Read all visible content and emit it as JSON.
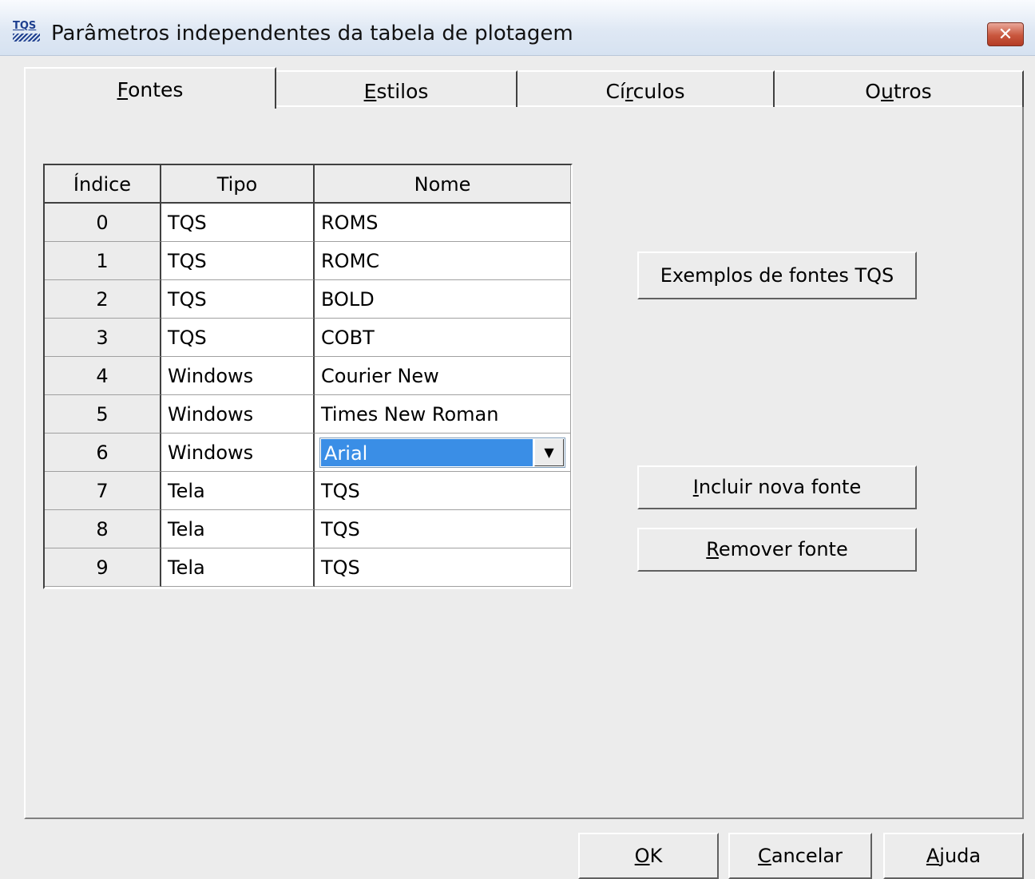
{
  "window": {
    "title": "Parâmetros independentes da tabela de plotagem",
    "icon_text": "TQS",
    "close_symbol": "✕"
  },
  "tabs": [
    {
      "prefix": "",
      "accel": "F",
      "rest": "ontes",
      "active": true
    },
    {
      "prefix": "",
      "accel": "E",
      "rest": "stilos",
      "active": false
    },
    {
      "prefix": "Cí",
      "accel": "r",
      "rest": "culos",
      "active": false
    },
    {
      "prefix": "O",
      "accel": "u",
      "rest": "tros",
      "active": false
    }
  ],
  "table": {
    "headers": [
      "Índice",
      "Tipo",
      "Nome"
    ],
    "rows": [
      {
        "indice": "0",
        "tipo": "TQS",
        "nome": "ROMS"
      },
      {
        "indice": "1",
        "tipo": "TQS",
        "nome": "ROMC"
      },
      {
        "indice": "2",
        "tipo": "TQS",
        "nome": "BOLD"
      },
      {
        "indice": "3",
        "tipo": "TQS",
        "nome": "COBT"
      },
      {
        "indice": "4",
        "tipo": "Windows",
        "nome": "Courier New"
      },
      {
        "indice": "5",
        "tipo": "Windows",
        "nome": "Times New Roman"
      },
      {
        "indice": "6",
        "tipo": "Windows",
        "nome": "Arial"
      },
      {
        "indice": "7",
        "tipo": "Tela",
        "nome": "TQS"
      },
      {
        "indice": "8",
        "tipo": "Tela",
        "nome": "TQS"
      },
      {
        "indice": "9",
        "tipo": "Tela",
        "nome": "TQS"
      }
    ],
    "editing_row": 6,
    "dropdown_arrow": "▼"
  },
  "side_buttons": {
    "exemplos": "Exemplos de fontes TQS",
    "incluir": {
      "accel": "I",
      "rest": "ncluir nova fonte"
    },
    "remover": {
      "accel": "R",
      "rest": "emover fonte"
    }
  },
  "footer_buttons": {
    "ok": {
      "accel": "O",
      "rest": "K"
    },
    "cancelar": {
      "accel": "C",
      "rest": "ancelar"
    },
    "ajuda": {
      "accel": "A",
      "rest": "juda"
    }
  }
}
